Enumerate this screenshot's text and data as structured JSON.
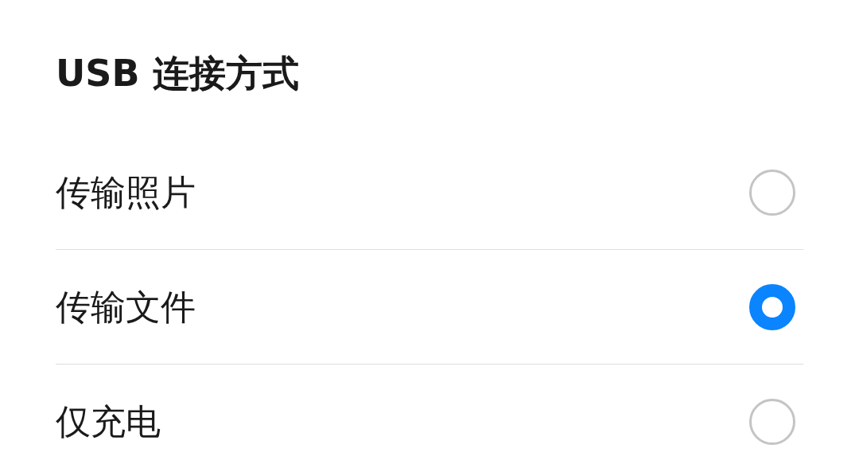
{
  "title": "USB 连接方式",
  "options": [
    {
      "label": "传输照片",
      "selected": false
    },
    {
      "label": "传输文件",
      "selected": true
    },
    {
      "label": "仅充电",
      "selected": false
    }
  ]
}
